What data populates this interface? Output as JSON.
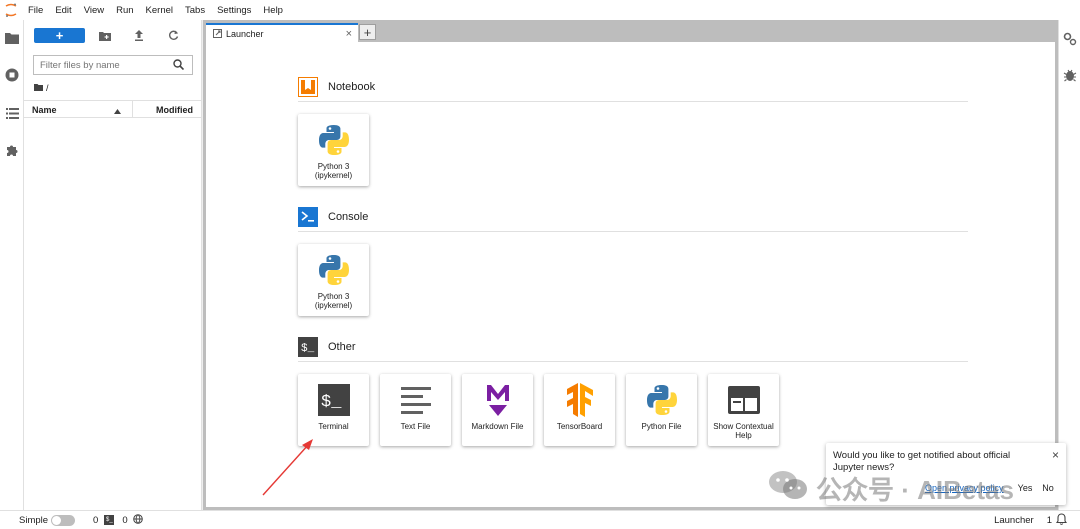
{
  "menubar": {
    "items": [
      "File",
      "Edit",
      "View",
      "Run",
      "Kernel",
      "Tabs",
      "Settings",
      "Help"
    ]
  },
  "leftbar": {
    "icons": [
      "folder-icon",
      "running-icon",
      "toc-icon",
      "extension-icon"
    ]
  },
  "filebrowser": {
    "new_label": "+",
    "filter_placeholder": "Filter files by name",
    "breadcrumb": "/",
    "col_name": "Name",
    "col_modified": "Modified"
  },
  "dock": {
    "tab_label": "Launcher",
    "add_tab": "+"
  },
  "launcher": {
    "sections": [
      {
        "title": "Notebook",
        "cards": [
          {
            "label": "Python 3 (ipykernel)",
            "icon": "python-icon"
          }
        ]
      },
      {
        "title": "Console",
        "cards": [
          {
            "label": "Python 3 (ipykernel)",
            "icon": "python-icon"
          }
        ]
      },
      {
        "title": "Other",
        "cards": [
          {
            "label": "Terminal",
            "icon": "terminal-icon"
          },
          {
            "label": "Text File",
            "icon": "text-file-icon"
          },
          {
            "label": "Markdown File",
            "icon": "markdown-icon"
          },
          {
            "label": "TensorBoard",
            "icon": "tensorboard-icon"
          },
          {
            "label": "Python File",
            "icon": "python-icon"
          },
          {
            "label": "Show Contextual Help",
            "icon": "contextual-help-icon"
          }
        ]
      }
    ]
  },
  "notification": {
    "message": "Would you like to get notified about official Jupyter news?",
    "link": "Open privacy policy",
    "yes": "Yes",
    "no": "No",
    "close": "×"
  },
  "watermark": {
    "text": "公众号 · AIBetas"
  },
  "statusbar": {
    "mode": "Simple",
    "terminals": "0",
    "kernels": "0",
    "activity": "Launcher",
    "notifications": "1"
  },
  "colors": {
    "accent": "#1976d2",
    "notebook_orange": "#f57c00",
    "console_blue": "#1976d2",
    "markdown_purple": "#7b1fa2",
    "annotation_red": "#e53935"
  }
}
